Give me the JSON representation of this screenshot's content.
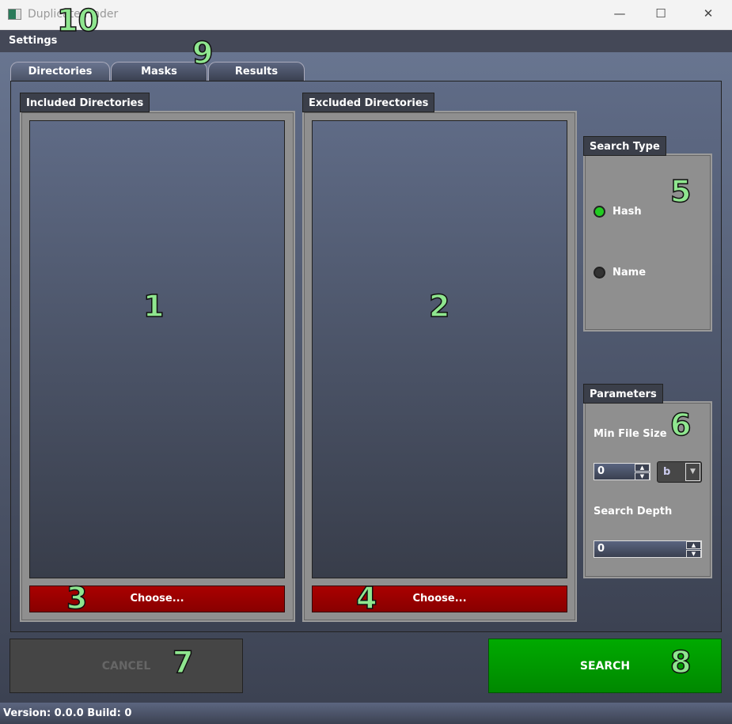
{
  "window": {
    "title": "Duplicate Finder",
    "minimize": "—",
    "maximize": "☐",
    "close": "✕"
  },
  "menu": {
    "settings": "Settings"
  },
  "tabs": [
    {
      "label": "Directories",
      "active": true
    },
    {
      "label": "Masks"
    },
    {
      "label": "Results"
    }
  ],
  "included": {
    "title": "Included Directories",
    "choose": "Choose..."
  },
  "excluded": {
    "title": "Excluded Directories",
    "choose": "Choose..."
  },
  "search_type": {
    "title": "Search Type",
    "options": [
      {
        "label": "Hash",
        "selected": true
      },
      {
        "label": "Name",
        "selected": false
      }
    ],
    "selected_color": "#22cc22"
  },
  "parameters": {
    "title": "Parameters",
    "min_file_size_label": "Min File Size",
    "min_file_size": "0",
    "unit": "b",
    "search_depth_label": "Search Depth",
    "search_depth": "0"
  },
  "actions": {
    "cancel": "CANCEL",
    "search": "SEARCH"
  },
  "status": {
    "text": "Version: 0.0.0 Build: 0"
  },
  "annotations": [
    "1",
    "2",
    "3",
    "4",
    "5",
    "6",
    "7",
    "8",
    "9",
    "10"
  ]
}
